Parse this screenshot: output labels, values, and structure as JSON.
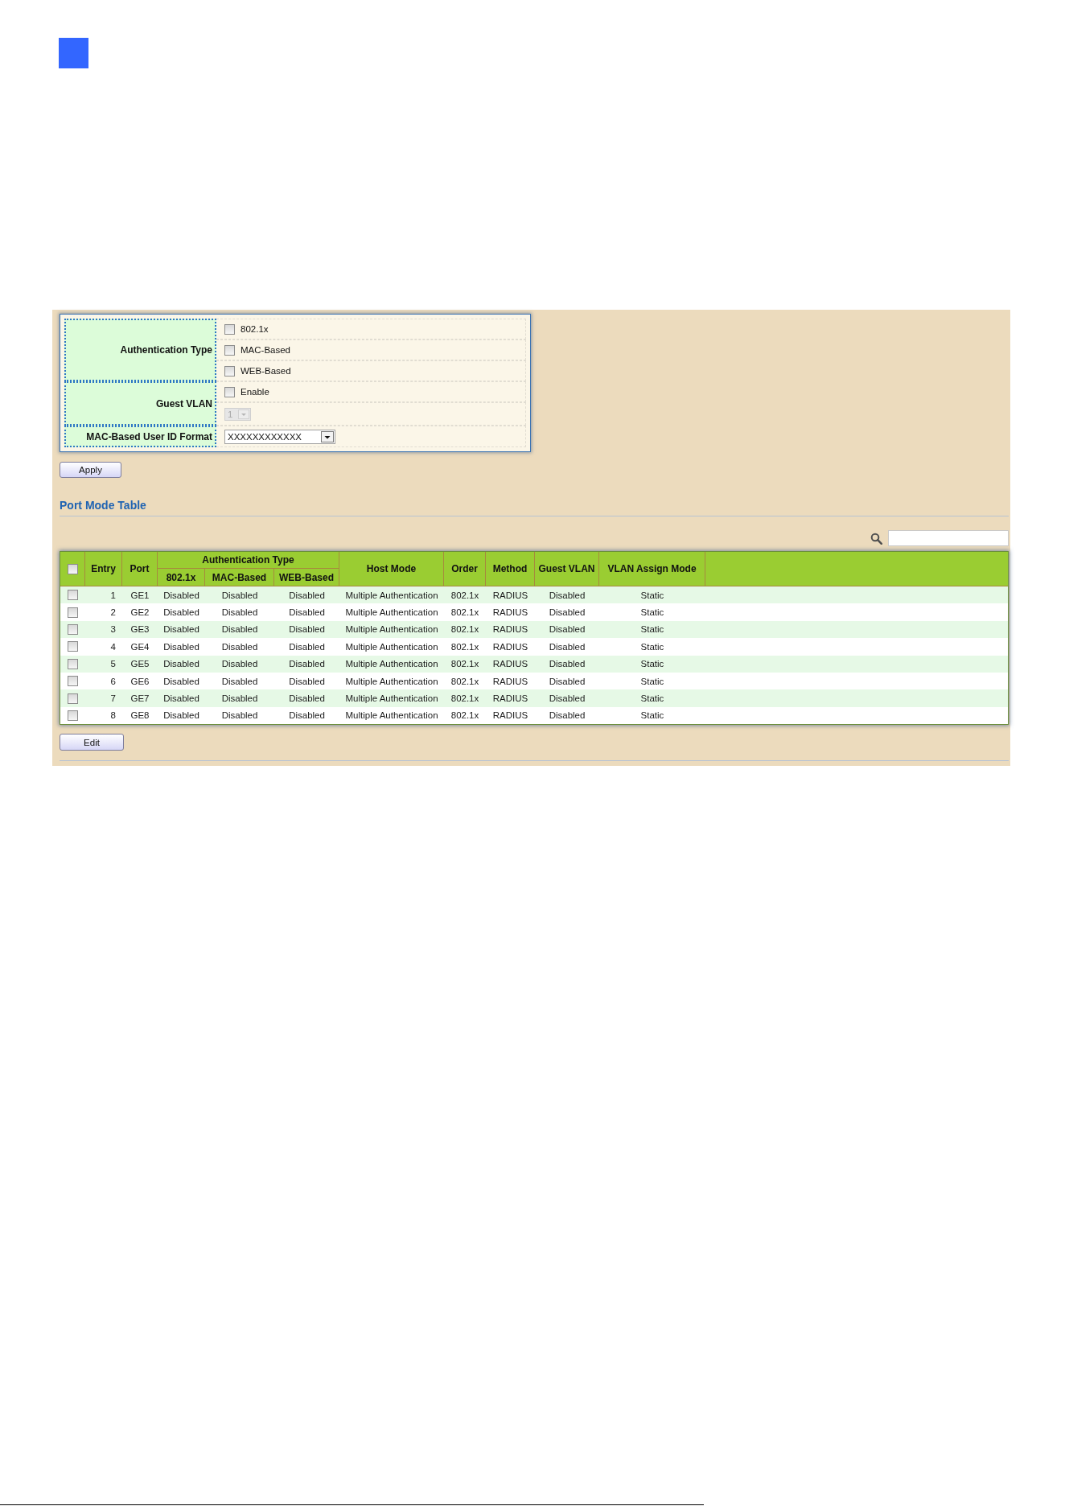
{
  "authentication_settings": {
    "authentication_type": {
      "label": "Authentication Type",
      "options": [
        {
          "label": "802.1x",
          "checked": false
        },
        {
          "label": "MAC-Based",
          "checked": false
        },
        {
          "label": "WEB-Based",
          "checked": false
        }
      ]
    },
    "guest_vlan": {
      "label": "Guest VLAN",
      "enable": {
        "label": "Enable",
        "checked": false
      },
      "vlan": {
        "value": "1",
        "disabled": true
      }
    },
    "mac_based_user_id_format": {
      "label": "MAC-Based User ID Format",
      "value": "XXXXXXXXXXXX"
    }
  },
  "apply_button": {
    "label": "Apply"
  },
  "port_mode_table": {
    "title": "Port Mode Table",
    "select_all": {
      "checked": false
    },
    "columns": [
      {
        "label": "Entry"
      },
      {
        "label": "Port"
      },
      {
        "label": "Authentication Type",
        "colspan": 3,
        "children": [
          {
            "label": "802.1x"
          },
          {
            "label": "MAC-Based"
          },
          {
            "label": "WEB-Based"
          }
        ]
      },
      {
        "label": "Host Mode"
      },
      {
        "label": "Order"
      },
      {
        "label": "Method"
      },
      {
        "label": "Guest VLAN"
      },
      {
        "label": "VLAN Assign Mode"
      }
    ],
    "rows": [
      {
        "checked": false,
        "cells": [
          "1",
          "GE1",
          "Disabled",
          "Disabled",
          "Disabled",
          "Multiple Authentication",
          "802.1x",
          "RADIUS",
          "Disabled",
          "Static"
        ]
      },
      {
        "checked": false,
        "cells": [
          "2",
          "GE2",
          "Disabled",
          "Disabled",
          "Disabled",
          "Multiple Authentication",
          "802.1x",
          "RADIUS",
          "Disabled",
          "Static"
        ]
      },
      {
        "checked": false,
        "cells": [
          "3",
          "GE3",
          "Disabled",
          "Disabled",
          "Disabled",
          "Multiple Authentication",
          "802.1x",
          "RADIUS",
          "Disabled",
          "Static"
        ]
      },
      {
        "checked": false,
        "cells": [
          "4",
          "GE4",
          "Disabled",
          "Disabled",
          "Disabled",
          "Multiple Authentication",
          "802.1x",
          "RADIUS",
          "Disabled",
          "Static"
        ]
      },
      {
        "checked": false,
        "cells": [
          "5",
          "GE5",
          "Disabled",
          "Disabled",
          "Disabled",
          "Multiple Authentication",
          "802.1x",
          "RADIUS",
          "Disabled",
          "Static"
        ]
      },
      {
        "checked": false,
        "cells": [
          "6",
          "GE6",
          "Disabled",
          "Disabled",
          "Disabled",
          "Multiple Authentication",
          "802.1x",
          "RADIUS",
          "Disabled",
          "Static"
        ]
      },
      {
        "checked": false,
        "cells": [
          "7",
          "GE7",
          "Disabled",
          "Disabled",
          "Disabled",
          "Multiple Authentication",
          "802.1x",
          "RADIUS",
          "Disabled",
          "Static"
        ]
      },
      {
        "checked": false,
        "cells": [
          "8",
          "GE8",
          "Disabled",
          "Disabled",
          "Disabled",
          "Multiple Authentication",
          "802.1x",
          "RADIUS",
          "Disabled",
          "Static"
        ]
      }
    ]
  },
  "edit_button": {
    "label": "Edit"
  }
}
